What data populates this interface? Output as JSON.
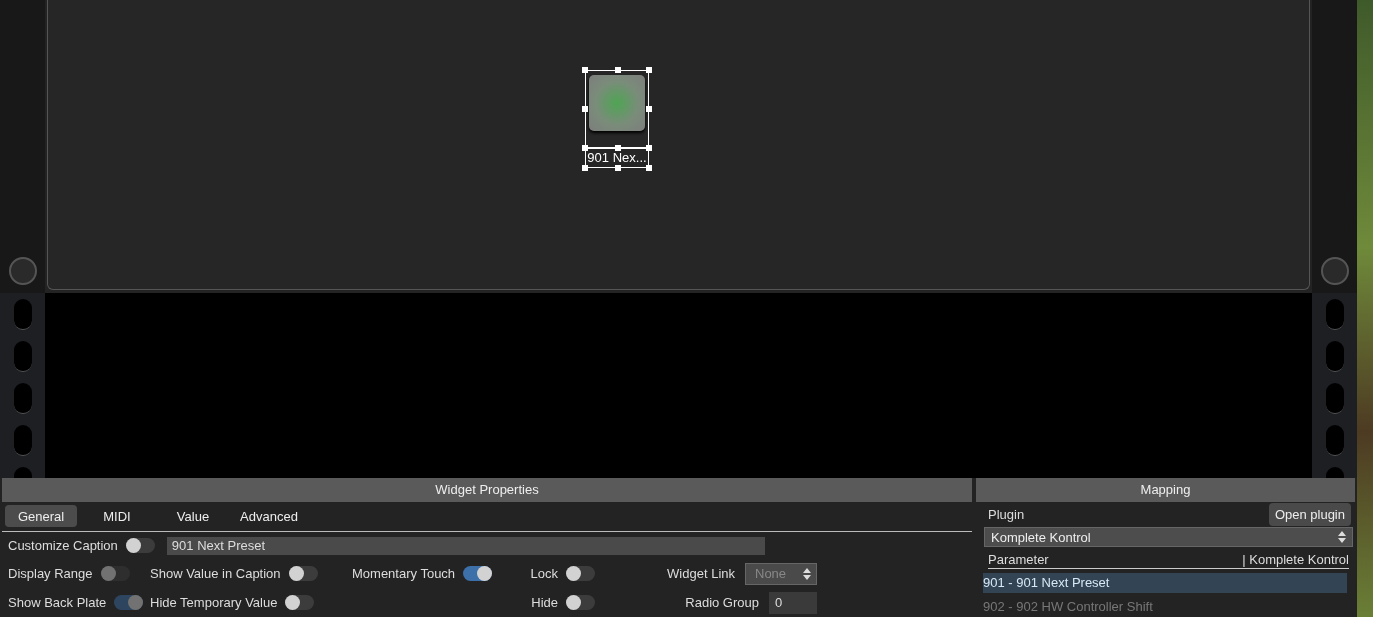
{
  "canvas": {
    "widget": {
      "caption": "901 Nex...",
      "lit": true,
      "selected": true
    }
  },
  "widget_properties": {
    "title": "Widget Properties",
    "tabs": [
      {
        "label": "General",
        "selected": true
      },
      {
        "label": "MIDI",
        "selected": false
      },
      {
        "label": "Value",
        "selected": false
      },
      {
        "label": "Advanced",
        "selected": false
      }
    ],
    "caption_row": {
      "label": "Customize Caption",
      "on": false,
      "value": "901 Next Preset"
    },
    "rows": [
      [
        {
          "kind": "toggle",
          "label": "Display Range",
          "on": false,
          "disabled": true
        },
        {
          "kind": "toggle",
          "label": "Show Value in Caption",
          "on": false,
          "disabled": false
        },
        {
          "kind": "toggle",
          "label": "Momentary Touch",
          "on": true,
          "disabled": false
        },
        {
          "kind": "toggle",
          "label": "Lock",
          "on": false,
          "disabled": false
        },
        {
          "kind": "select",
          "label": "Widget Link",
          "value": "None",
          "disabled": true
        }
      ],
      [
        {
          "kind": "toggle",
          "label": "Show Back Plate",
          "on": true,
          "disabled": true
        },
        {
          "kind": "toggle",
          "label": "Hide Temporary Value",
          "on": false,
          "disabled": false
        },
        {
          "kind": "empty"
        },
        {
          "kind": "toggle",
          "label": "Hide",
          "on": false,
          "disabled": false
        },
        {
          "kind": "field",
          "label": "Radio Group",
          "value": "0"
        }
      ]
    ]
  },
  "mapping": {
    "title": "Mapping",
    "plugin_label": "Plugin",
    "open_button": "Open plugin",
    "plugin_select": "Komplete Kontrol",
    "columns": [
      "Parameter",
      "| Komplete Kontrol"
    ],
    "parameters": [
      {
        "label": "901 - 901 Next Preset",
        "selected": true
      },
      {
        "label": "902 - 902 HW Controller Shift",
        "selected": false
      }
    ]
  }
}
